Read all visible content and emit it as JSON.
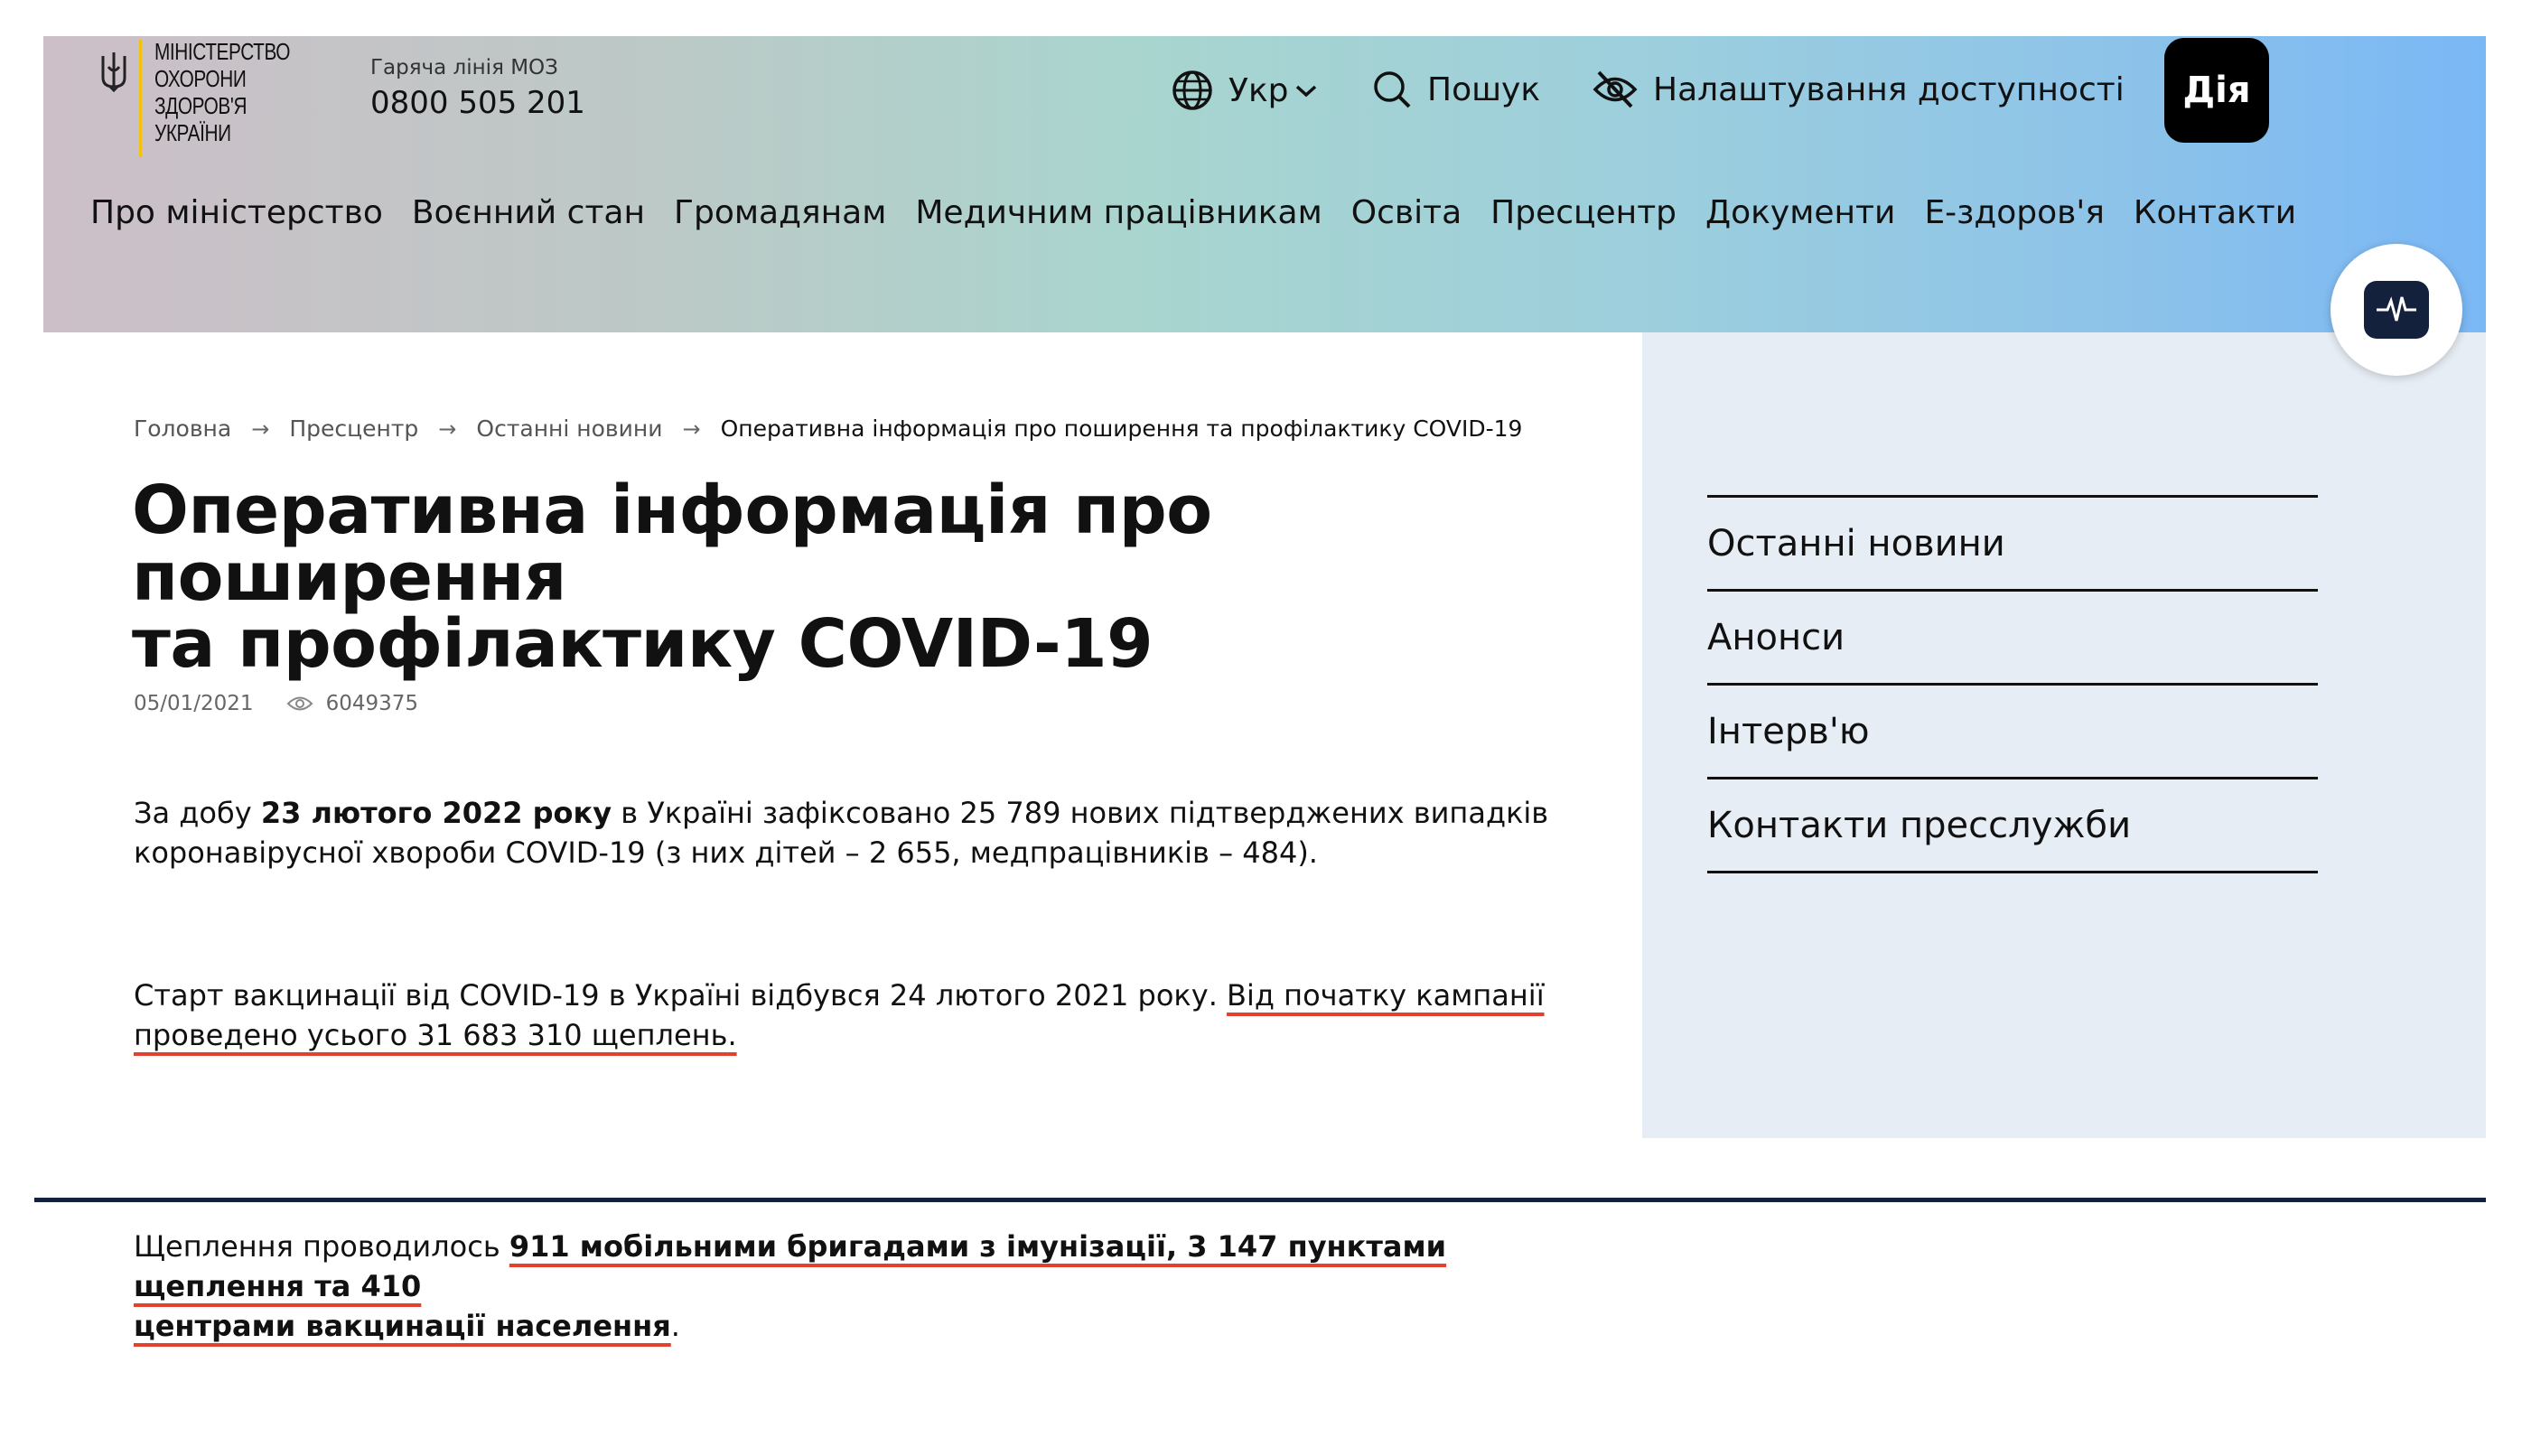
{
  "header": {
    "logo_lines": [
      "МІНІСТЕРСТВО",
      "ОХОРОНИ",
      "ЗДОРОВ'Я",
      "УКРАЇНИ"
    ],
    "hotline_label": "Гаряча лінія МОЗ",
    "hotline_number": "0800 505 201",
    "language": "Укр",
    "search": "Пошук",
    "accessibility": "Налаштування доступності",
    "diia": "Дія"
  },
  "nav": [
    "Про міністерство",
    "Воєнний стан",
    "Громадянам",
    "Медичним працівникам",
    "Освіта",
    "Пресцентр",
    "Документи",
    "Е-здоров'я",
    "Контакти"
  ],
  "breadcrumbs": [
    "Головна",
    "Пресцентр",
    "Останні новини",
    "Оперативна інформація про поширення та профілактику COVID-19"
  ],
  "article": {
    "title_line1": "Оперативна інформація про поширення",
    "title_line2": "та профілактику COVID-19",
    "date": "05/01/2021",
    "views": "6049375",
    "p1": {
      "a": "За добу ",
      "b": "23 лютого 2022 року",
      "c": " в Україні зафіксовано 25 789 нових підтверджених випадків",
      "d": "коронавірусної хвороби COVID-19 (з них дітей – 2 655,  медпрацівників – 484)."
    },
    "p2": {
      "a": "Старт вакцинації від COVID-19 в Україні відбувся 24 лютого 2021 року. ",
      "b": "Від початку кампанії",
      "c": "проведено усього 31 683 310 щеплень",
      "d": "."
    },
    "p3": {
      "a": "Щеплення проводилось ",
      "b": "911 мобільними бригадами з імунізації, 3 147 пунктами щеплення та 410",
      "c": "центрами вакцинації населення",
      "d": "."
    }
  },
  "sidebar": [
    "Останні новини",
    "Анонси",
    "Інтерв'ю",
    "Контакти пресслужби"
  ],
  "colors": {
    "accent_underline": "#e2412f",
    "rule": "#14213d",
    "sidebar_bg": "#e7edf4"
  }
}
